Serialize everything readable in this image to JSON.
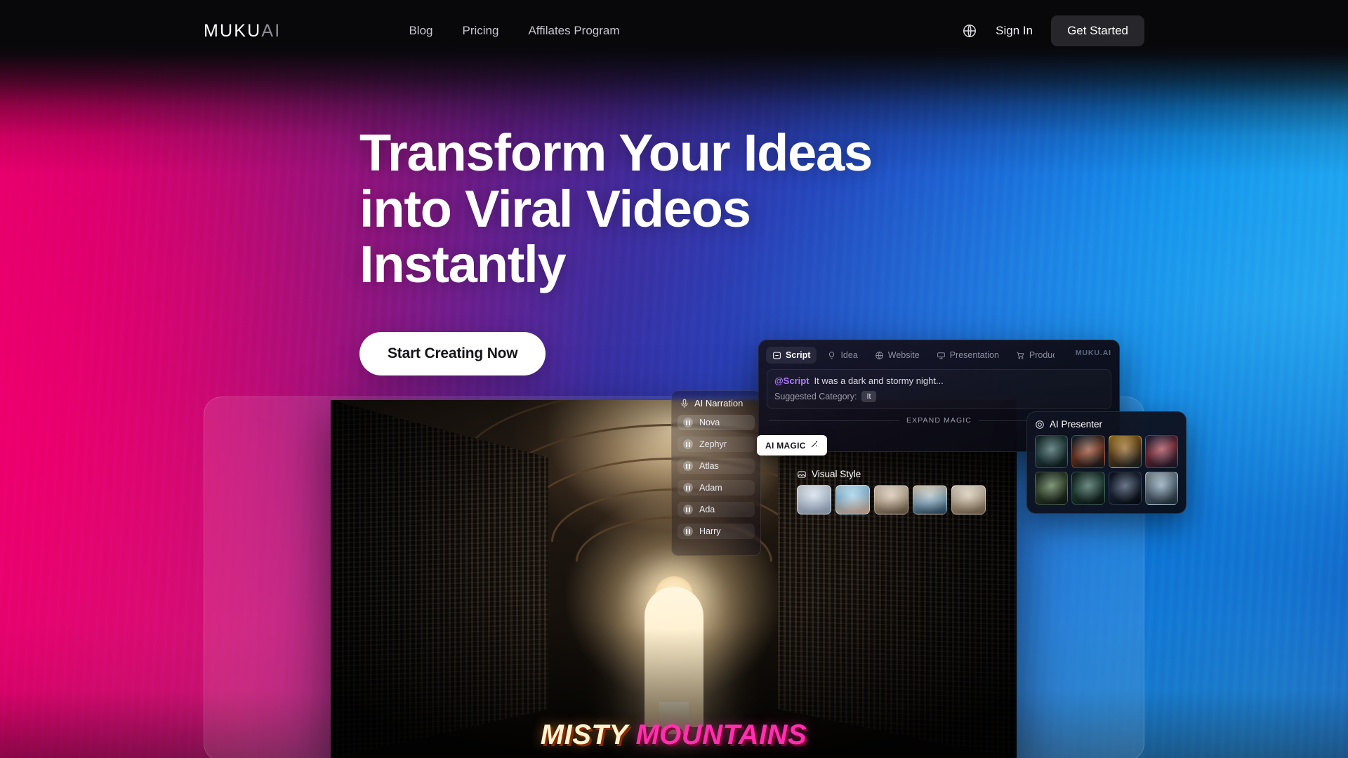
{
  "brand": {
    "name_primary": "MUKU",
    "name_secondary": "AI"
  },
  "nav": {
    "links": [
      {
        "label": "Blog"
      },
      {
        "label": "Pricing"
      },
      {
        "label": "Affilates Program"
      }
    ],
    "language_icon": "globe-icon",
    "sign_in": "Sign In",
    "get_started": "Get Started"
  },
  "hero": {
    "headline_line1": "Transform Your Ideas",
    "headline_line2": "into Viral Videos",
    "headline_line3": "Instantly",
    "cta": "Start Creating Now"
  },
  "narration": {
    "title": "AI Narration",
    "icon": "microphone-icon",
    "voices": [
      {
        "name": "Nova",
        "selected": true
      },
      {
        "name": "Zephyr",
        "selected": false
      },
      {
        "name": "Atlas",
        "selected": false
      },
      {
        "name": "Adam",
        "selected": false
      },
      {
        "name": "Ada",
        "selected": false
      },
      {
        "name": "Harry",
        "selected": false
      }
    ]
  },
  "script_panel": {
    "watermark": "MUKU.AI",
    "tabs": [
      {
        "label": "Script",
        "icon": "script-icon",
        "active": true
      },
      {
        "label": "Idea",
        "icon": "lightbulb-icon",
        "active": false
      },
      {
        "label": "Website",
        "icon": "globe-icon",
        "active": false
      },
      {
        "label": "Presentation",
        "icon": "presentation-icon",
        "active": false
      },
      {
        "label": "Produc",
        "icon": "cart-icon",
        "active": false
      }
    ],
    "mention": "@Script",
    "script_text": "It was a dark and stormy night...",
    "category_label": "Suggested Category:",
    "category_value": "It",
    "expand_label": "EXPAND MAGIC",
    "ai_magic_button": "AI MAGIC",
    "ai_magic_icon": "wand-icon"
  },
  "visual_style": {
    "title": "Visual Style",
    "icon": "image-icon",
    "thumbs": [
      "vt1",
      "vt2",
      "vt3",
      "vt4",
      "vt5"
    ]
  },
  "presenter": {
    "title": "AI Presenter",
    "icon": "avatar-icon",
    "thumbs": [
      "pt1",
      "pt2",
      "pt3",
      "pt4",
      "pt5",
      "pt6",
      "pt7",
      "pt8"
    ]
  },
  "video_preview": {
    "caption_part1": "MISTY",
    "caption_part2": "MOUNTAINS"
  },
  "colors": {
    "accent_pink": "#ff2fb0",
    "accent_blue": "#1aa6ef",
    "mention_purple": "#b07bff",
    "nav_bg": "#08080b",
    "button_dark": "#26262b"
  }
}
